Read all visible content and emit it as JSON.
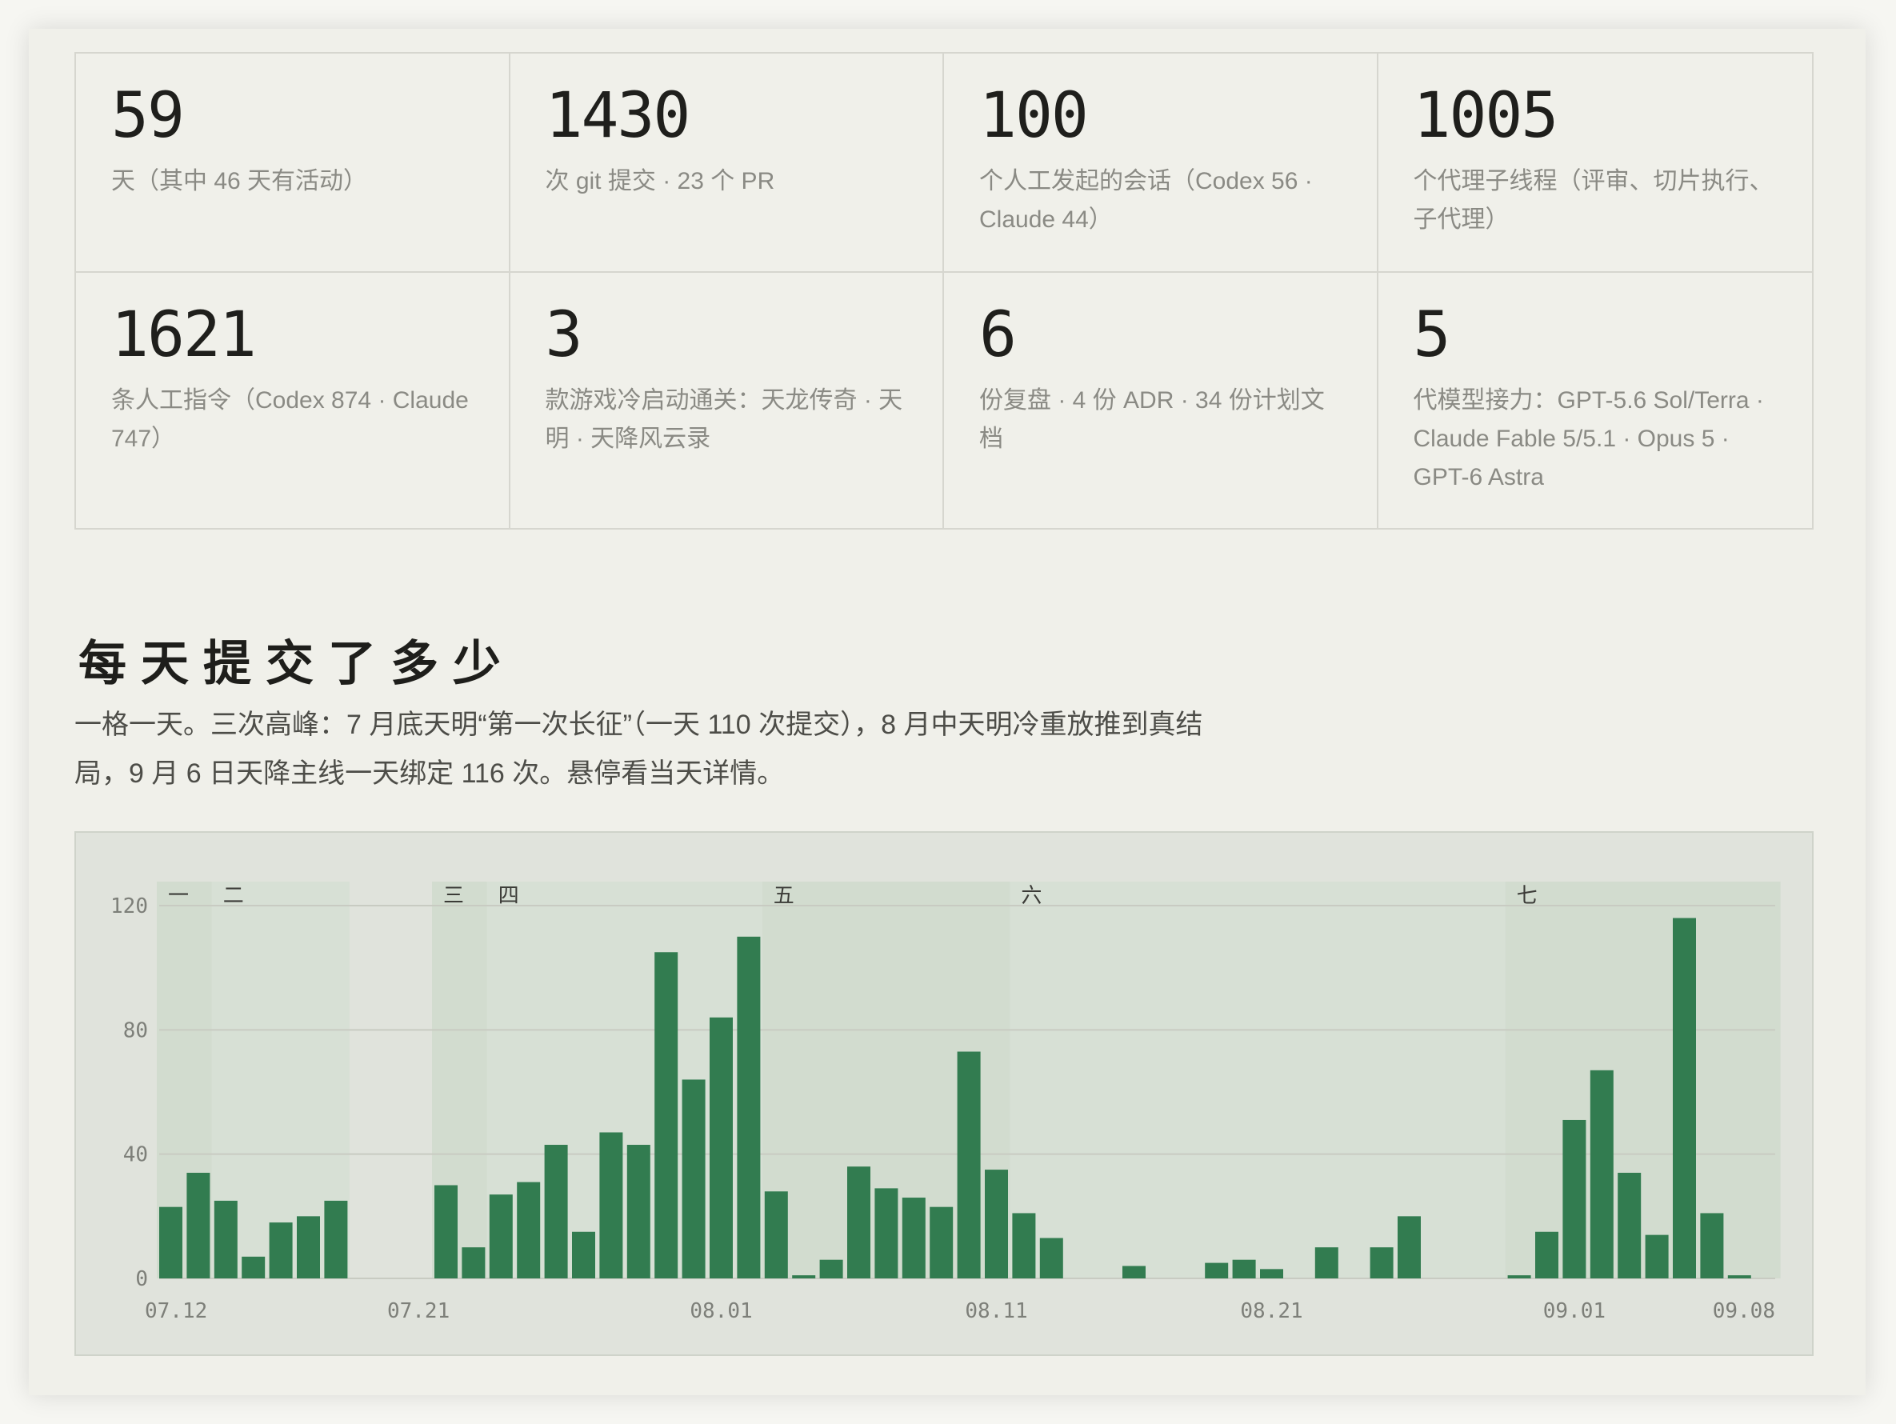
{
  "stats": [
    {
      "number": "59",
      "desc": "天（其中 46 天有活动）"
    },
    {
      "number": "1430",
      "desc": "次 git 提交 · 23 个 PR"
    },
    {
      "number": "100",
      "desc": "个人工发起的会话（Codex 56 · Claude 44）"
    },
    {
      "number": "1005",
      "desc": "个代理子线程（评审、切片执行、子代理）"
    },
    {
      "number": "1621",
      "desc": "条人工指令（Codex 874 · Claude 747）"
    },
    {
      "number": "3",
      "desc": "款游戏冷启动通关：天龙传奇 · 天明 · 天降风云录"
    },
    {
      "number": "6",
      "desc": "份复盘 · 4 份 ADR · 34 份计划文档"
    },
    {
      "number": "5",
      "desc": "代模型接力：GPT-5.6 Sol/Terra · Claude Fable 5/5.1 · Opus 5 · GPT-6 Astra"
    }
  ],
  "section": {
    "title": "每天提交了多少",
    "subtitle": "一格一天。三次高峰：7 月底天明“第一次长征”（一天 110 次提交），8 月中天明冷重放推到真结局，9 月 6 日天降主线一天绑定 116 次。悬停看当天详情。"
  },
  "colors": {
    "bar": "#327c50",
    "phase_band": "#d5dfd3",
    "phase_band_alt": "#cfdbcd",
    "grid": "#c8cbc2"
  },
  "chart_data": {
    "type": "bar",
    "dates_start": "07.12",
    "dates_end": "09.08",
    "x": [
      "07.12",
      "07.13",
      "07.14",
      "07.15",
      "07.16",
      "07.17",
      "07.18",
      "07.19",
      "07.20",
      "07.21",
      "07.22",
      "07.23",
      "07.24",
      "07.25",
      "07.26",
      "07.27",
      "07.28",
      "07.29",
      "07.30",
      "07.31",
      "08.01",
      "08.02",
      "08.03",
      "08.04",
      "08.05",
      "08.06",
      "08.07",
      "08.08",
      "08.09",
      "08.10",
      "08.11",
      "08.12",
      "08.13",
      "08.14",
      "08.15",
      "08.16",
      "08.17",
      "08.18",
      "08.19",
      "08.20",
      "08.21",
      "08.22",
      "08.23",
      "08.24",
      "08.25",
      "08.26",
      "08.27",
      "08.28",
      "08.29",
      "08.30",
      "08.31",
      "09.01",
      "09.02",
      "09.03",
      "09.04",
      "09.05",
      "09.06",
      "09.07",
      "09.08"
    ],
    "values": [
      23,
      34,
      25,
      7,
      18,
      20,
      25,
      0,
      0,
      0,
      30,
      10,
      27,
      31,
      43,
      15,
      47,
      43,
      105,
      64,
      84,
      110,
      28,
      1,
      6,
      36,
      29,
      26,
      23,
      73,
      35,
      21,
      13,
      0,
      0,
      4,
      0,
      0,
      5,
      6,
      3,
      0,
      10,
      0,
      10,
      20,
      0,
      0,
      0,
      1,
      15,
      51,
      67,
      34,
      14,
      116,
      21,
      1,
      0
    ],
    "x_ticks": [
      "07.12",
      "07.21",
      "08.01",
      "08.11",
      "08.21",
      "09.01",
      "09.08"
    ],
    "y_ticks": [
      0,
      40,
      80,
      120
    ],
    "ylim": [
      0,
      120
    ],
    "phases": [
      {
        "label": "一",
        "start": "07.12",
        "end": "07.13"
      },
      {
        "label": "二",
        "start": "07.14",
        "end": "07.18"
      },
      {
        "label": "三",
        "start": "07.22",
        "end": "07.23"
      },
      {
        "label": "四",
        "start": "07.24",
        "end": "08.02"
      },
      {
        "label": "五",
        "start": "08.03",
        "end": "08.11"
      },
      {
        "label": "六",
        "start": "08.12",
        "end": "08.29"
      },
      {
        "label": "七",
        "start": "08.30",
        "end": "09.08"
      }
    ],
    "grid": true,
    "xlabel": "",
    "ylabel": ""
  }
}
